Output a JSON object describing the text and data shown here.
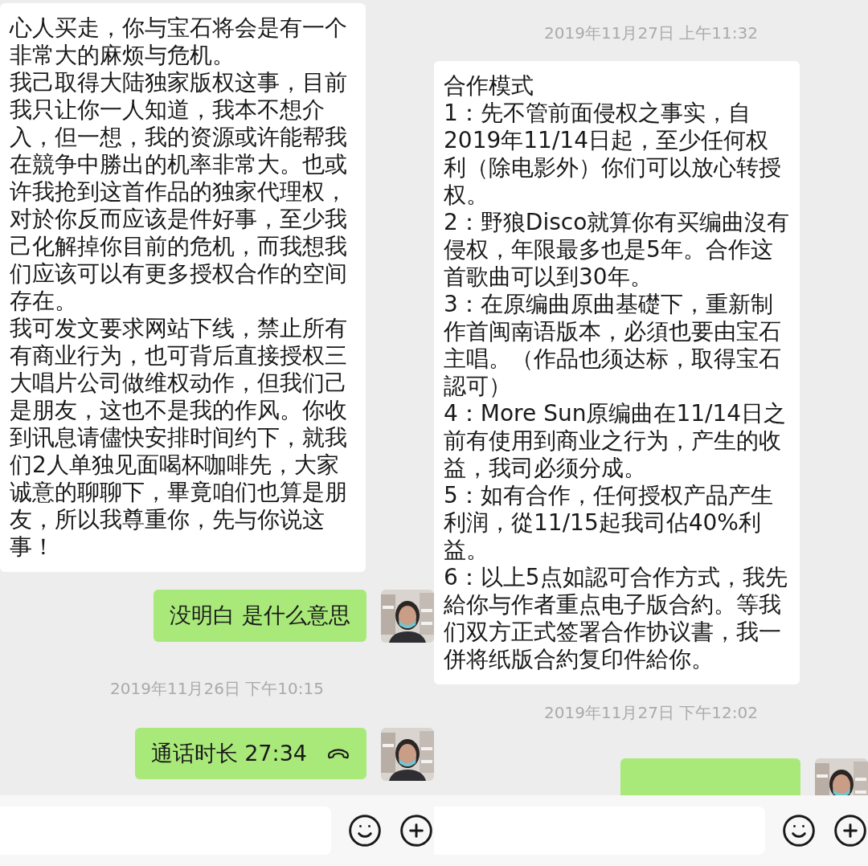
{
  "panels": [
    {
      "messages": [
        {
          "kind": "received",
          "paragraphs": [
            "心人买走，你与宝石将会是有一个非常大的麻烦与危机。",
            "我己取得大陆独家版权这事，目前我只让你一人知道，我本不想介入，但一想，我的资源或许能帮我在競争中勝出的机率非常大。也或许我抢到这首作品的独家代理权，对於你反而应该是件好事，至少我己化解掉你目前的危机，而我想我们应该可以有更多授权合作的空间存在。",
            "我可发文要求网站下线，禁止所有有商业行为，也可背后直接授权三大唱片公司做维权动作，但我们己是朋友，这也不是我的作风。你收到讯息请儘快安排时间约下，就我们2人单独见面喝杯咖啡先，大家诚意的聊聊下，畢竟咱们也算是朋友，所以我尊重你，先与你说这事！"
          ]
        },
        {
          "kind": "sent",
          "text": "没明白 是什么意思"
        },
        {
          "kind": "time",
          "text": "2019年11月26日 下午10:15"
        },
        {
          "kind": "call",
          "text": "通话时长 27:34"
        }
      ]
    },
    {
      "messages": [
        {
          "kind": "time",
          "text": "2019年11月27日 上午11:32"
        },
        {
          "kind": "received",
          "paragraphs": [
            "合作模式",
            "1：先不管前面侵权之事实，自2019年11/14日起，至少任何权利（除电影外）你们可以放心转授权。",
            "2：野狼Disco就算你有买编曲沒有侵权，年限最多也是5年。合作这首歌曲可以到30年。",
            "3：在原编曲原曲基礎下，重新制作首闽南语版本，必須也要由宝石主唱。（作品也须达标，取得宝石認可）",
            "4：More Sun原编曲在11/14日之前有使用到商业之行为，产生的收益，我司必须分成。",
            "5：如有合作，任何授权产品产生利润，從11/15起我司佔40%利益。",
            "6：以上5点如認可合作方式，我先給你与作者重点电子版合約。等我们双方正式签署合作协议書，我一併将纸版合約复印件給你。"
          ]
        },
        {
          "kind": "time",
          "text": "2019年11月27日 下午12:02"
        },
        {
          "kind": "sent"
        }
      ]
    }
  ]
}
